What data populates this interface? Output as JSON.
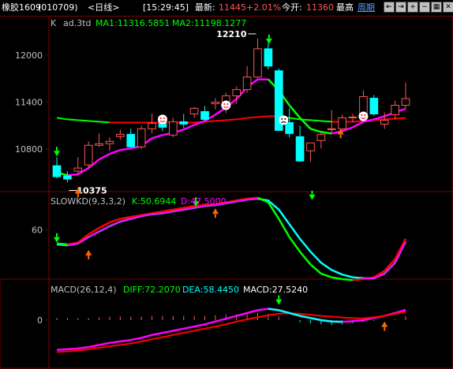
{
  "header": {
    "symbol": "橡胶1609",
    "code": "(010709)",
    "period": "<日线>",
    "time": "[15:29:45]",
    "latest_label": "最新:",
    "latest_value": "11445",
    "change_pct": "+2.01%",
    "open_label": "今开:",
    "open_value": "11360",
    "high_label": "最高",
    "period_link": "周期"
  },
  "toolbar": {
    "buttons": [
      {
        "name": "back-button",
        "icon": "⇤"
      },
      {
        "name": "forward-button",
        "icon": "⇥"
      },
      {
        "name": "zoom-in-button",
        "icon": "+"
      },
      {
        "name": "zoom-out-button",
        "icon": "−"
      },
      {
        "name": "grid-button",
        "icon": "▦"
      },
      {
        "name": "close-button",
        "icon": "✕"
      }
    ]
  },
  "main_panel": {
    "title_k": "K",
    "title_name": "ad.3td",
    "ma1_label": "MA1:11316.5851",
    "ma2_label": "MA2:11198.1277",
    "high_mark": "12210",
    "low_mark": "10375",
    "y_ticks": [
      {
        "label": "12000",
        "value": 12000
      },
      {
        "label": "11400",
        "value": 11400
      },
      {
        "label": "10800",
        "value": 10800
      }
    ]
  },
  "kd_panel": {
    "title": "SLOWKD(9,3,3,2)",
    "k_label": "K:50.6944",
    "d_label": "D:47.5000",
    "y_ticks": [
      {
        "label": "60",
        "value": 60
      }
    ]
  },
  "macd_panel": {
    "title": "MACD(26,12,4)",
    "diff_label": "DIFF:72.2070",
    "dea_label": "DEA:58.4450",
    "macd_label": "MACD:27.5240",
    "y_ticks": [
      {
        "label": "0",
        "value": 0
      }
    ]
  },
  "colors": {
    "up": "#ff5555",
    "down": "#00ffff",
    "ma1": "#ff00ff",
    "ma2_red": "#ff0000",
    "ma2_green": "#00ff00",
    "axis": "#800000",
    "label": "#c0c0c0"
  },
  "chart_data": {
    "type": "candlestick",
    "candles": [
      {
        "o": 10590,
        "h": 10700,
        "l": 10430,
        "c": 10450
      },
      {
        "o": 10460,
        "h": 10520,
        "l": 10375,
        "c": 10420
      },
      {
        "o": 10520,
        "h": 10700,
        "l": 10480,
        "c": 10560
      },
      {
        "o": 10600,
        "h": 10900,
        "l": 10550,
        "c": 10850
      },
      {
        "o": 10850,
        "h": 11000,
        "l": 10830,
        "c": 10870
      },
      {
        "o": 10870,
        "h": 10950,
        "l": 10780,
        "c": 10900
      },
      {
        "o": 10960,
        "h": 11050,
        "l": 10920,
        "c": 10990
      },
      {
        "o": 10990,
        "h": 11060,
        "l": 10820,
        "c": 10830
      },
      {
        "o": 10830,
        "h": 11100,
        "l": 10800,
        "c": 11060
      },
      {
        "o": 11060,
        "h": 11250,
        "l": 11000,
        "c": 11130
      },
      {
        "o": 11130,
        "h": 11180,
        "l": 11030,
        "c": 11080
      },
      {
        "o": 10980,
        "h": 11200,
        "l": 10950,
        "c": 11150
      },
      {
        "o": 11150,
        "h": 11250,
        "l": 11070,
        "c": 11120
      },
      {
        "o": 11250,
        "h": 11340,
        "l": 11200,
        "c": 11320
      },
      {
        "o": 11280,
        "h": 11350,
        "l": 11160,
        "c": 11180
      },
      {
        "o": 11380,
        "h": 11450,
        "l": 11310,
        "c": 11400
      },
      {
        "o": 11400,
        "h": 11520,
        "l": 11260,
        "c": 11480
      },
      {
        "o": 11480,
        "h": 11600,
        "l": 11380,
        "c": 11560
      },
      {
        "o": 11560,
        "h": 11860,
        "l": 11520,
        "c": 11720
      },
      {
        "o": 11720,
        "h": 12210,
        "l": 11700,
        "c": 12080
      },
      {
        "o": 12080,
        "h": 12150,
        "l": 11820,
        "c": 11860
      },
      {
        "o": 11800,
        "h": 11830,
        "l": 11030,
        "c": 11040
      },
      {
        "o": 11140,
        "h": 11320,
        "l": 10950,
        "c": 11000
      },
      {
        "o": 10960,
        "h": 11100,
        "l": 10640,
        "c": 10650
      },
      {
        "o": 10780,
        "h": 10880,
        "l": 10640,
        "c": 10880
      },
      {
        "o": 10910,
        "h": 11030,
        "l": 10810,
        "c": 10990
      },
      {
        "o": 11050,
        "h": 11300,
        "l": 11000,
        "c": 11060
      },
      {
        "o": 11060,
        "h": 11240,
        "l": 11000,
        "c": 11200
      },
      {
        "o": 11200,
        "h": 11250,
        "l": 11140,
        "c": 11210
      },
      {
        "o": 11210,
        "h": 11550,
        "l": 11180,
        "c": 11470
      },
      {
        "o": 11450,
        "h": 11490,
        "l": 11230,
        "c": 11250
      },
      {
        "o": 11120,
        "h": 11270,
        "l": 11060,
        "c": 11170
      },
      {
        "o": 11240,
        "h": 11420,
        "l": 11180,
        "c": 11360
      },
      {
        "o": 11360,
        "h": 11650,
        "l": 11320,
        "c": 11445
      }
    ],
    "ma1": [
      10500,
      10470,
      10480,
      10560,
      10670,
      10740,
      10790,
      10810,
      10840,
      10940,
      10980,
      11010,
      11050,
      11110,
      11160,
      11240,
      11330,
      11440,
      11590,
      11690,
      11690,
      11550,
      11360,
      11200,
      11060,
      11020,
      11000,
      11030,
      11080,
      11150,
      11180,
      11220,
      11270,
      11316
    ],
    "ma2": [
      11200,
      11180,
      11170,
      11160,
      11150,
      11140,
      11140,
      11140,
      11140,
      11140,
      11140,
      11140,
      11140,
      11140,
      11150,
      11160,
      11170,
      11180,
      11200,
      11210,
      11220,
      11220,
      11200,
      11180,
      11170,
      11160,
      11150,
      11150,
      11150,
      11160,
      11170,
      11180,
      11190,
      11198
    ],
    "kd_k": [
      45,
      44,
      46,
      55,
      62,
      68,
      72,
      74,
      76,
      78,
      80,
      82,
      84,
      86,
      87,
      88,
      90,
      92,
      94,
      95,
      90,
      72,
      52,
      36,
      22,
      12,
      8,
      6,
      5,
      6,
      8,
      15,
      28,
      50
    ],
    "kd_d": [
      44,
      43,
      45,
      52,
      58,
      64,
      69,
      72,
      75,
      77,
      78,
      80,
      82,
      84,
      86,
      87,
      89,
      91,
      93,
      94,
      92,
      82,
      66,
      50,
      36,
      24,
      16,
      11,
      8,
      7,
      7,
      12,
      24,
      47
    ],
    "macd_diff": [
      -210,
      -205,
      -200,
      -190,
      -175,
      -160,
      -150,
      -140,
      -125,
      -105,
      -90,
      -75,
      -60,
      -45,
      -30,
      -10,
      10,
      30,
      50,
      70,
      80,
      70,
      50,
      30,
      15,
      0,
      -10,
      -12,
      -8,
      0,
      15,
      30,
      50,
      72
    ],
    "macd_dea": [
      -225,
      -220,
      -215,
      -205,
      -195,
      -185,
      -175,
      -165,
      -150,
      -135,
      -120,
      -105,
      -90,
      -75,
      -60,
      -45,
      -30,
      -10,
      5,
      20,
      35,
      45,
      48,
      45,
      38,
      30,
      25,
      18,
      14,
      12,
      20,
      30,
      45,
      58
    ],
    "macd_hist": [
      15,
      15,
      15,
      15,
      20,
      25,
      25,
      25,
      25,
      30,
      30,
      30,
      30,
      30,
      30,
      35,
      40,
      40,
      45,
      50,
      45,
      25,
      2,
      -15,
      -23,
      -30,
      -35,
      -30,
      -22,
      -12,
      -5,
      0,
      5,
      27
    ]
  }
}
